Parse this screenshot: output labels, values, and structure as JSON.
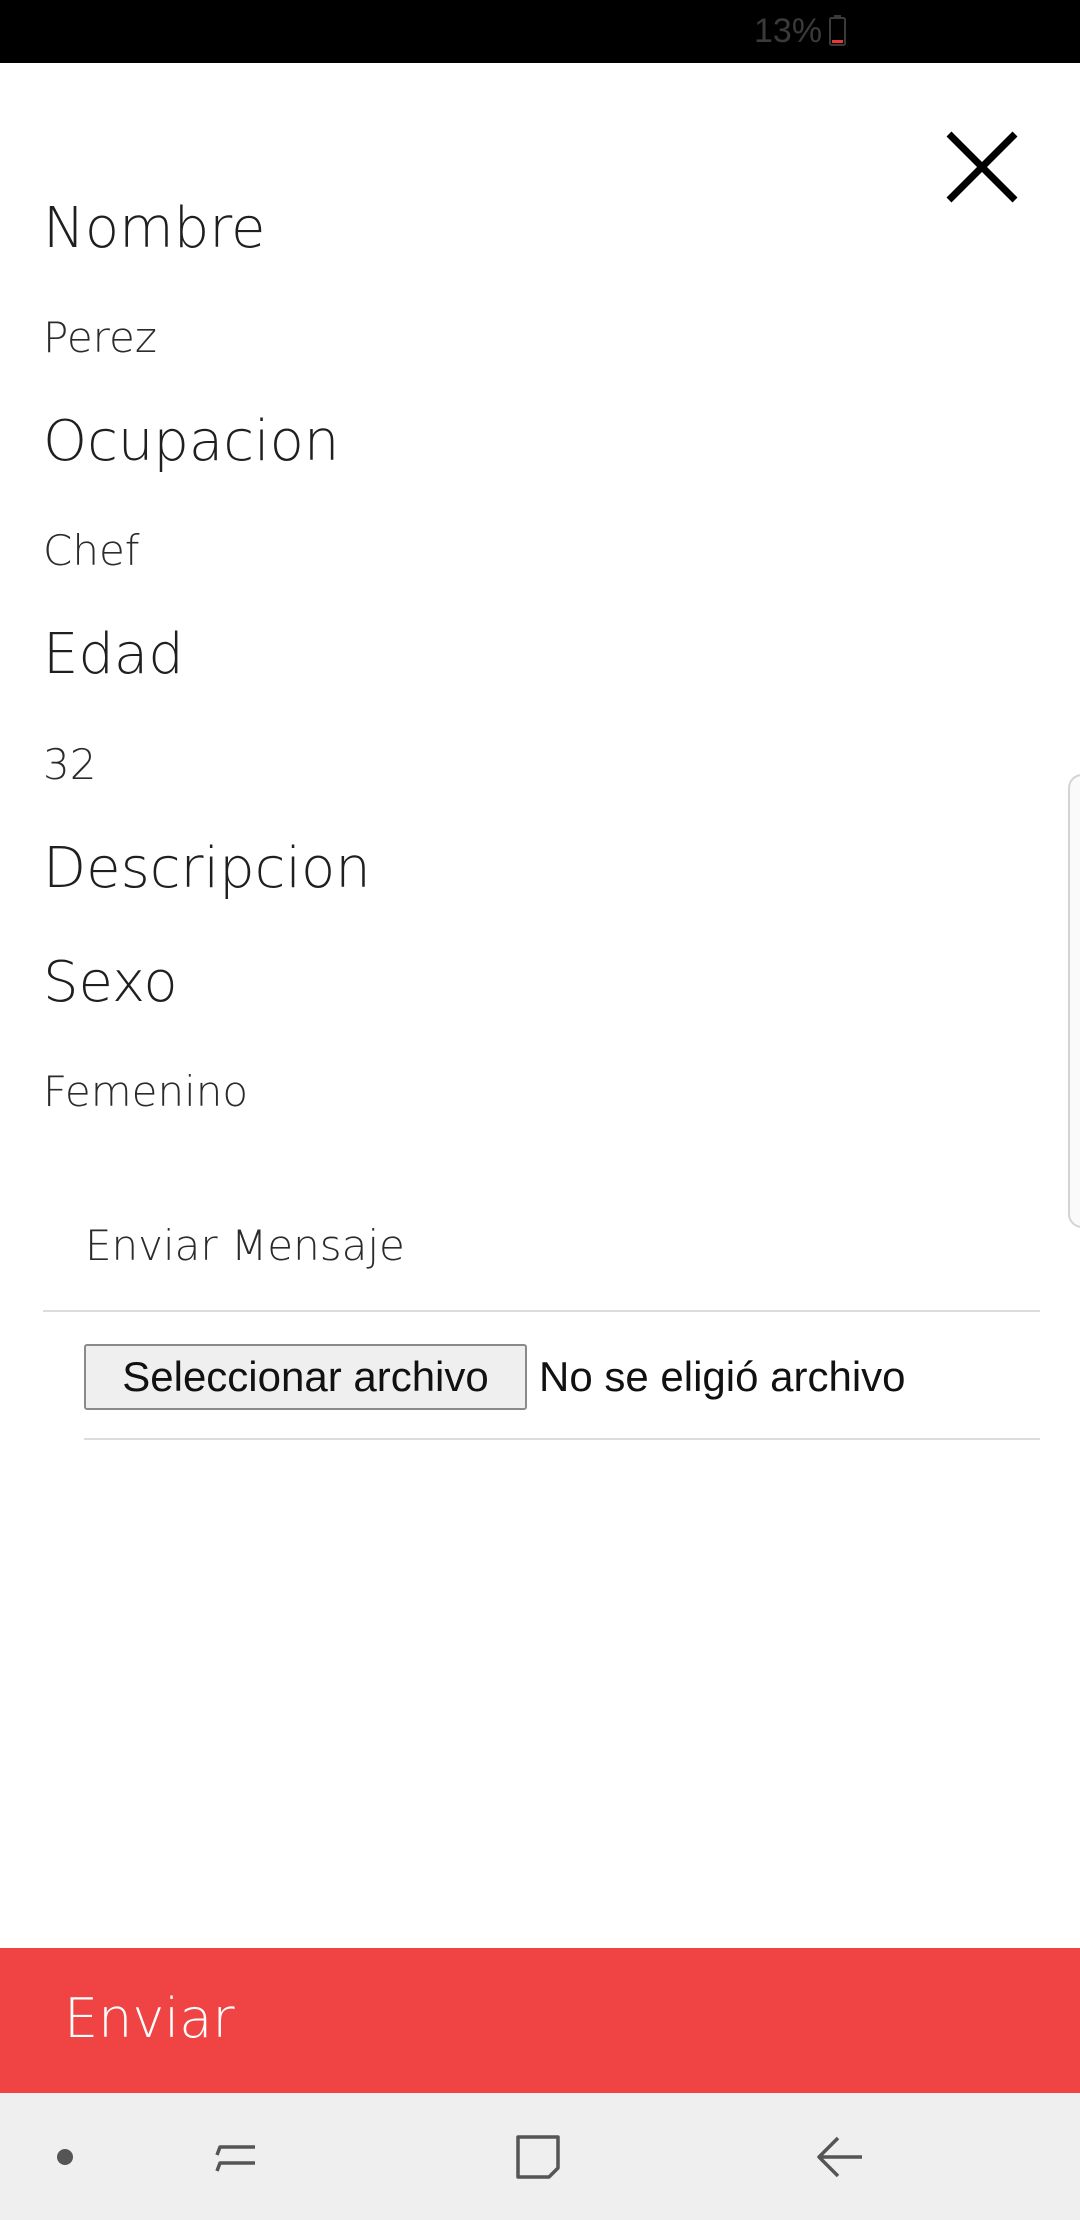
{
  "status_bar": {
    "battery_percent": "13%",
    "battery_icon": "battery-low-icon",
    "battery_level": 0.13
  },
  "header": {
    "close_icon": "close-icon"
  },
  "profile": {
    "fields": [
      {
        "label": "Nombre",
        "value": "Perez"
      },
      {
        "label": "Ocupacion",
        "value": "Chef"
      },
      {
        "label": "Edad",
        "value": "32"
      },
      {
        "label": "Descripcion",
        "value": ""
      },
      {
        "label": "Sexo",
        "value": "Femenino"
      }
    ]
  },
  "message": {
    "placeholder": "Enviar Mensaje",
    "value": ""
  },
  "file_upload": {
    "button_label": "Seleccionar archivo",
    "status": "No se eligió archivo"
  },
  "submit": {
    "label": "Enviar"
  },
  "colors": {
    "accent": "#f04444",
    "nav_background": "#efefef",
    "status_bar": "#000000"
  },
  "nav_bar": {
    "items": [
      "dot-icon",
      "recent-apps-icon",
      "home-icon",
      "back-icon"
    ]
  }
}
